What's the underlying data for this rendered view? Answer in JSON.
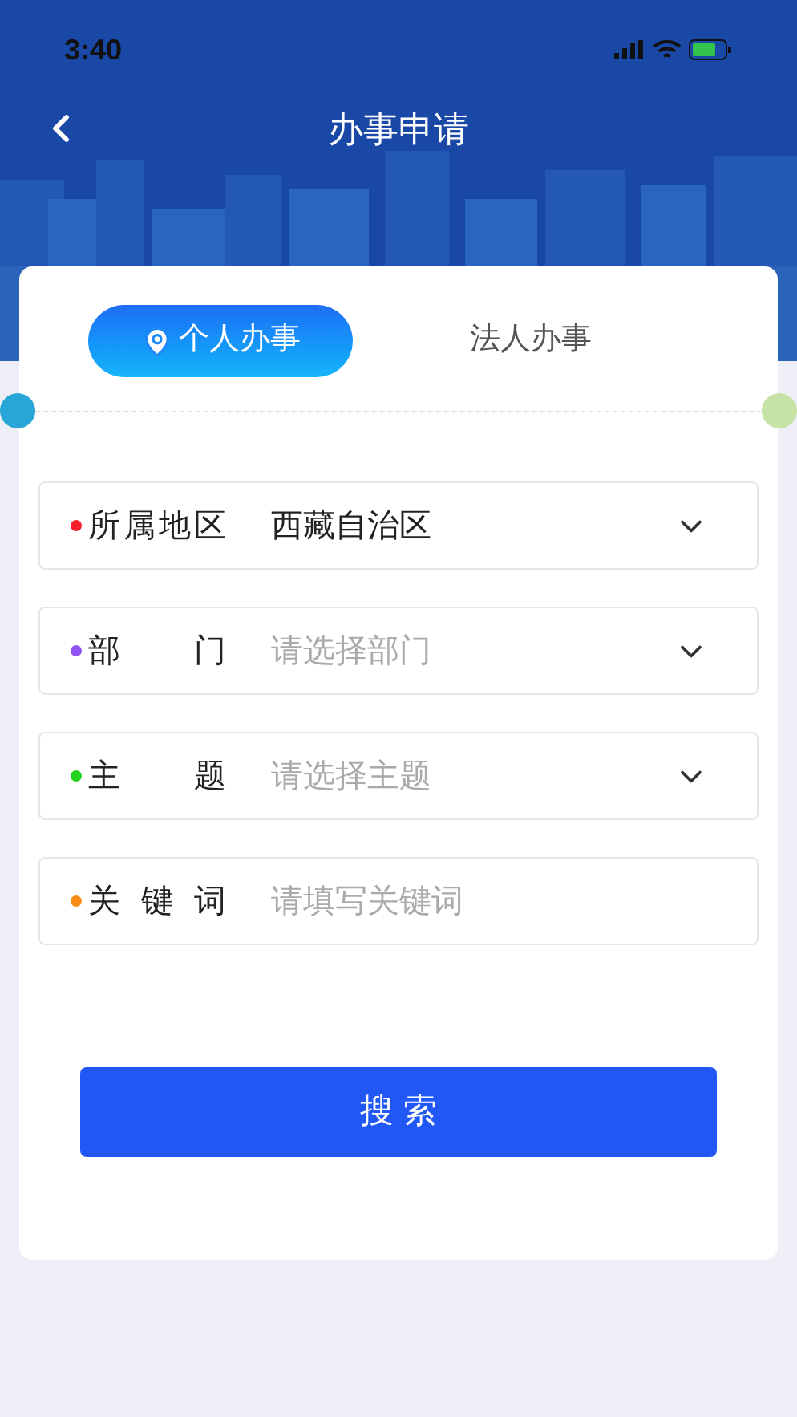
{
  "status_bar": {
    "time": "3:40"
  },
  "header": {
    "title": "办事申请"
  },
  "tabs": [
    {
      "label": "个人办事",
      "selected": true
    },
    {
      "label": "法人办事",
      "selected": false
    }
  ],
  "fields": [
    {
      "kind": "select",
      "label": "所属地区",
      "value": "西藏自治区",
      "color": "#f5222d"
    },
    {
      "kind": "select",
      "label": "部 门",
      "placeholder": "请选择部门",
      "color": "#9254f5"
    },
    {
      "kind": "select",
      "label": "主 题",
      "placeholder": "请选择主题",
      "color": "#22d322"
    },
    {
      "kind": "input",
      "label": "关 键 词",
      "placeholder": "请填写关键词",
      "color": "#fa8c16"
    }
  ],
  "search_button": {
    "label": "搜 索"
  }
}
